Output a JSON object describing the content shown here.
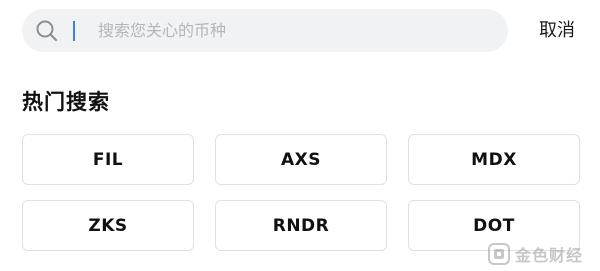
{
  "search": {
    "placeholder": "搜索您关心的币种",
    "value": "",
    "icon": "search-icon"
  },
  "header": {
    "cancel_label": "取消"
  },
  "hot_search": {
    "title": "热门搜索",
    "items": [
      {
        "label": "FIL"
      },
      {
        "label": "AXS"
      },
      {
        "label": "MDX"
      },
      {
        "label": "ZKS"
      },
      {
        "label": "RNDR"
      },
      {
        "label": "DOT"
      }
    ]
  },
  "watermark": {
    "text": "金色财经",
    "icon": "jinse-logo"
  },
  "colors": {
    "search_bg": "#f1f2f4",
    "caret": "#3d7bf7",
    "chip_border": "#dfe1e5",
    "placeholder": "#b3b6bc"
  }
}
